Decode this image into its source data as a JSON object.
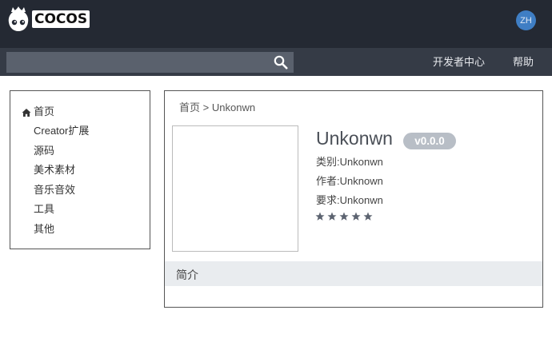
{
  "header": {
    "logo_text": "COCOS",
    "avatar_initials": "ZH"
  },
  "navbar": {
    "search_placeholder": "",
    "links": [
      "开发者中心",
      "帮助"
    ]
  },
  "sidebar": {
    "items": [
      {
        "label": "首页",
        "icon": "home-icon"
      },
      {
        "label": "Creator扩展"
      },
      {
        "label": "源码"
      },
      {
        "label": "美术素材"
      },
      {
        "label": "音乐音效"
      },
      {
        "label": "工具"
      },
      {
        "label": "其他"
      }
    ]
  },
  "breadcrumb": {
    "home": "首页",
    "separator": ">",
    "current": "Unkonwn"
  },
  "product": {
    "title": "Unkonwn",
    "version": "v0.0.0",
    "category_label": "类别:",
    "category_value": "Unkonwn",
    "author_label": "作者:",
    "author_value": "Unknown",
    "requirement_label": "要求:",
    "requirement_value": "Unkonwn",
    "rating_stars": 5,
    "star_color": "#5c6370"
  },
  "intro": {
    "label": "简介"
  },
  "colors": {
    "topbar": "#242933",
    "navbar": "#353b46",
    "search_bg": "#5a616d",
    "avatar": "#3f7ec4",
    "badge": "#b8bec6",
    "intro_bar": "#e9ecef"
  }
}
